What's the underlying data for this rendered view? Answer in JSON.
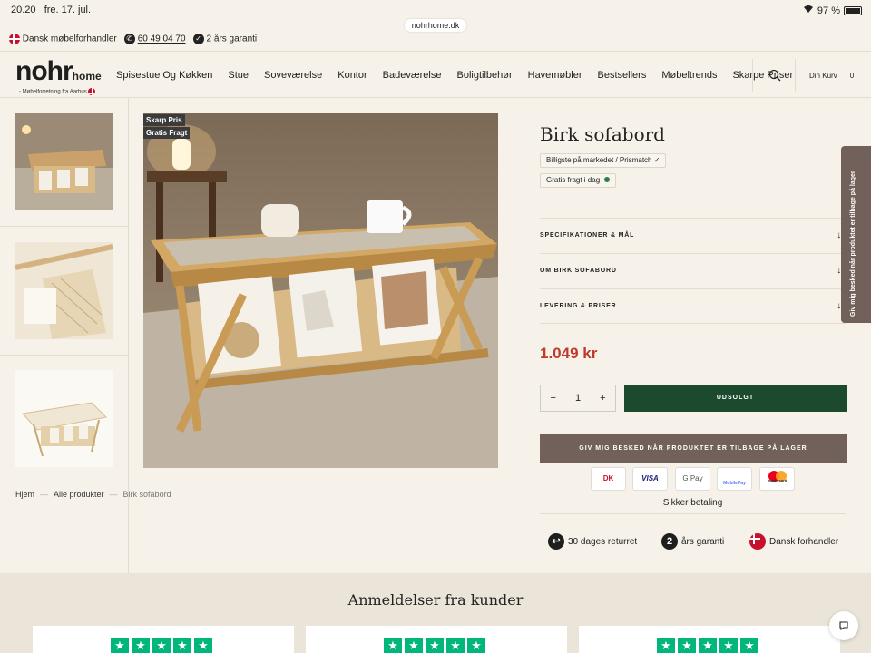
{
  "status": {
    "time": "20.20",
    "date": "fre. 17. jul.",
    "battery": "97 %"
  },
  "url": "nohrhome.dk",
  "topbar": {
    "dealer": "Dansk møbelforhandler",
    "phone": "60 49 04 70",
    "warranty": "2 års garanti"
  },
  "logo": {
    "main": "nohr",
    "suffix": "home",
    "tagline": "Møbelforretning fra Aarhus"
  },
  "nav": [
    "Spisestue Og Køkken",
    "Stue",
    "Soveværelse",
    "Kontor",
    "Badeværelse",
    "Boligtilbehør",
    "Havemøbler",
    "Bestsellers",
    "Møbeltrends",
    "Skarpe Priser"
  ],
  "cart": {
    "label": "Din Kurv",
    "count": "0"
  },
  "badges": [
    "Skarp Pris",
    "Gratis Fragt"
  ],
  "breadcrumb": [
    "Hjem",
    "Alle produkter",
    "Birk sofabord"
  ],
  "product": {
    "title": "Birk sofabord",
    "tags": [
      "Billigste på markedet / Prismatch ✓",
      "Gratis fragt i dag"
    ],
    "accordions": [
      "SPECIFIKATIONER & MÅL",
      "OM BIRK SOFABORD",
      "LEVERING & PRISER"
    ],
    "price": "1.049 kr",
    "qty": "1",
    "soldout": "UDSOLGT",
    "notify": "GIV MIG BESKED NÅR PRODUKTET ER TILBAGE PÅ LAGER",
    "payments": [
      "DK",
      "VISA",
      "G Pay",
      "MobilePay",
      "mastercard"
    ],
    "secure": "Sikker betaling",
    "trust": [
      {
        "icon": "return-icon",
        "label": "30 dages returret"
      },
      {
        "icon": "warranty-icon",
        "label": "års garanti"
      },
      {
        "icon": "danish-flag-icon",
        "label": "Dansk forhandler"
      }
    ]
  },
  "side_tab": "Giv mig besked når produktet er tilbage på lager",
  "reviews": {
    "title": "Anmeldelser fra kunder",
    "stars": "★"
  },
  "colors": {
    "soldout": "#1c4a2f",
    "notify": "#71615a",
    "price": "#c0392b",
    "trustpilot": "#00b67a",
    "bg": "#f6f2e9"
  }
}
